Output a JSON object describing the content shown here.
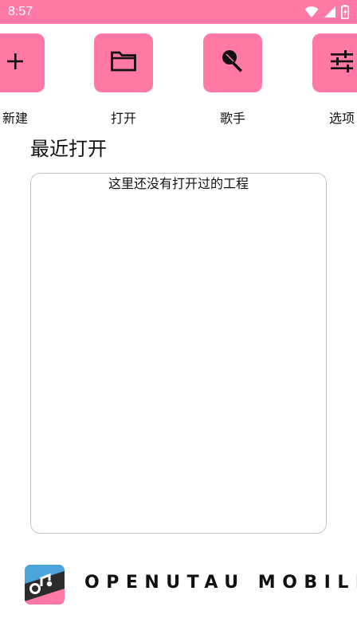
{
  "status_bar": {
    "time": "8:57",
    "icons": [
      "wifi-icon",
      "cellular-signal-icon",
      "battery-charging-icon"
    ],
    "color": "#ff79a4"
  },
  "actions": [
    {
      "label": "新建",
      "icon": "plus-icon"
    },
    {
      "label": "打开",
      "icon": "folder-icon"
    },
    {
      "label": "歌手",
      "icon": "microphone-icon"
    },
    {
      "label": "选项",
      "icon": "tune-sliders-icon"
    }
  ],
  "recent": {
    "title": "最近打开",
    "empty_message": "这里还没有打开过的工程"
  },
  "brand": {
    "name": "OPENUTAU MOBILE",
    "logo": "openutau-logo"
  },
  "colors": {
    "accent": "#ff79a4",
    "text": "#111111",
    "panel_border": "#c4c4c4"
  }
}
